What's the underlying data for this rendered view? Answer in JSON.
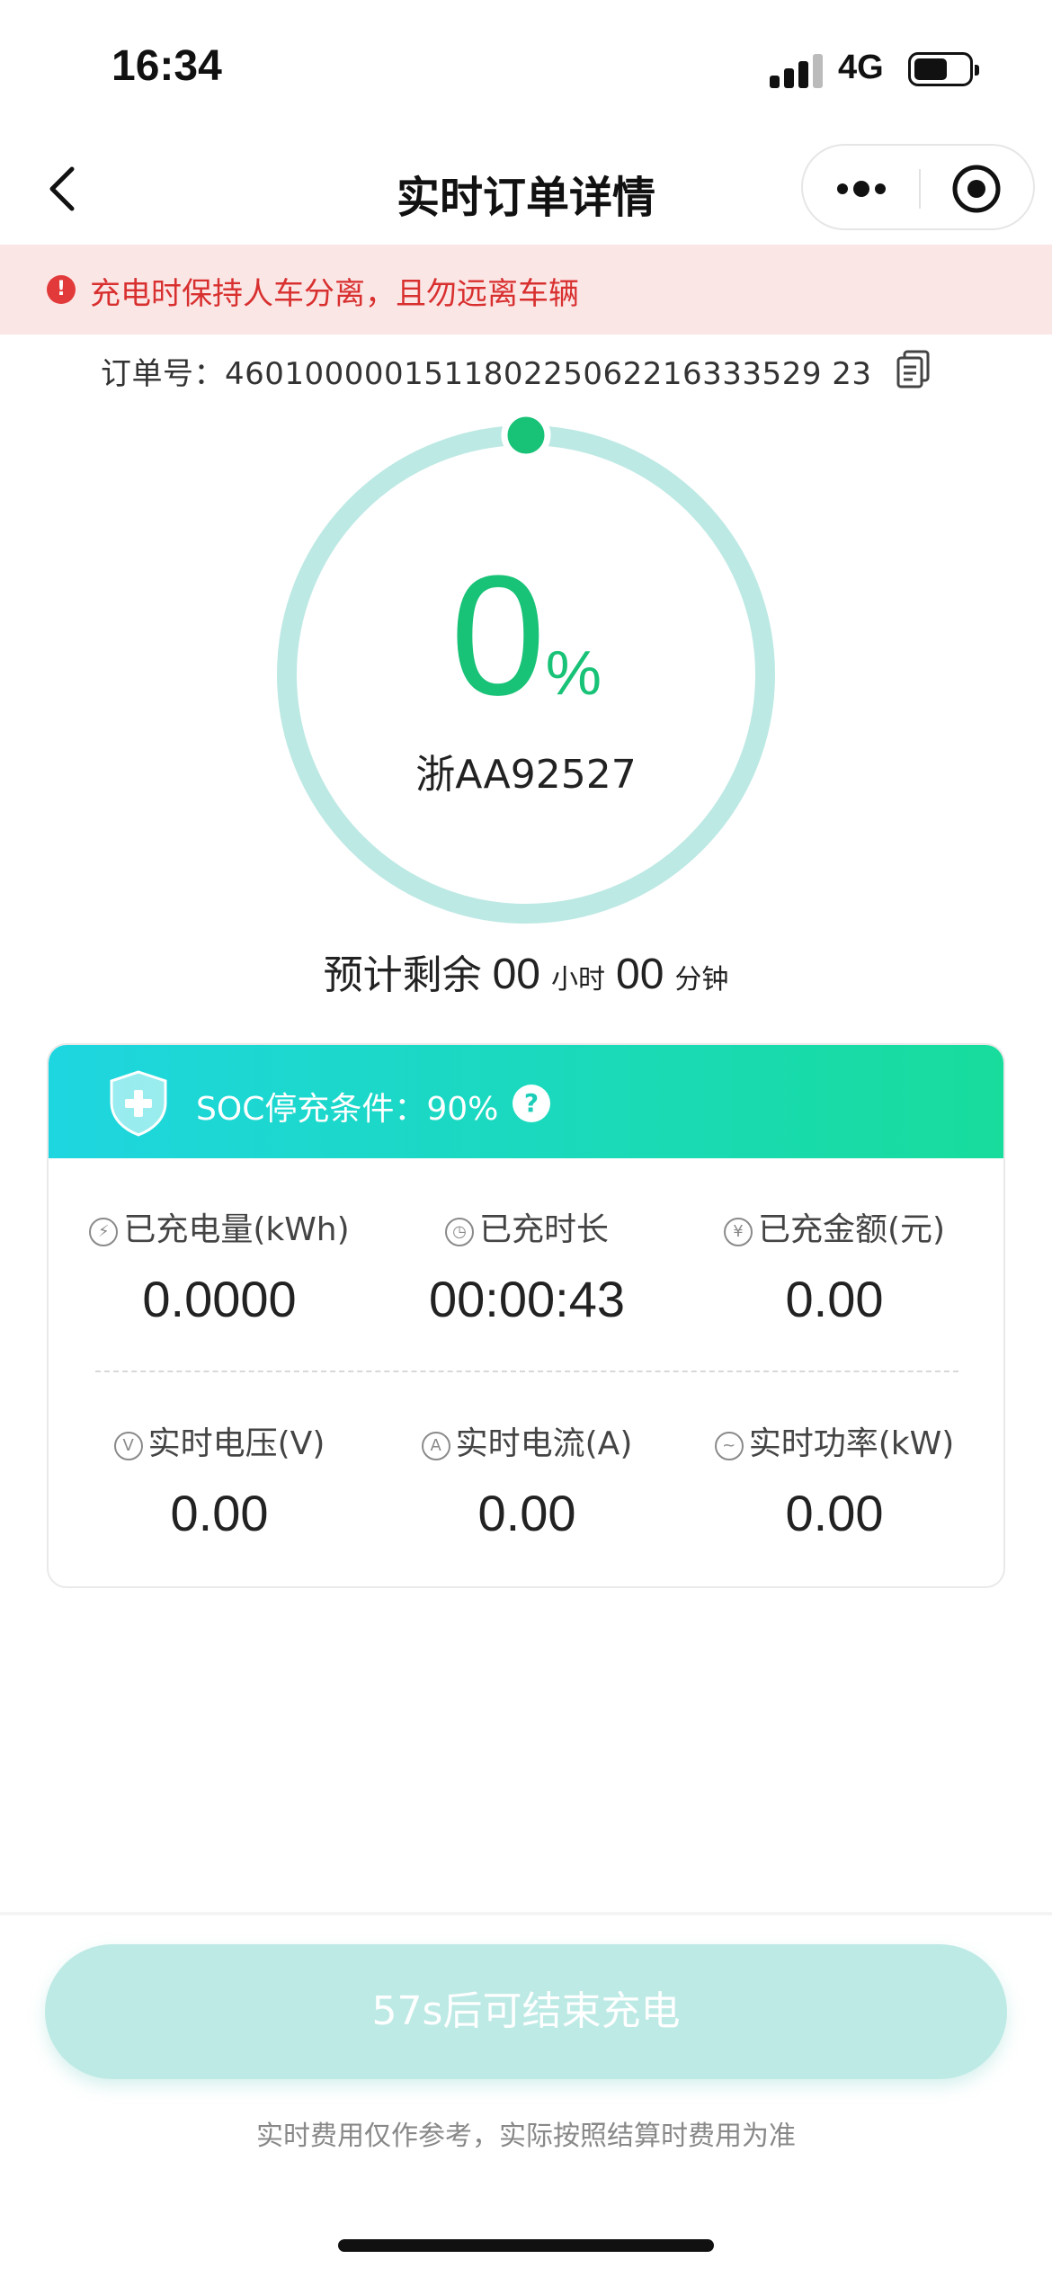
{
  "status_bar": {
    "time": "16:34",
    "network": "4G"
  },
  "nav": {
    "title": "实时订单详情"
  },
  "warning": {
    "icon": "!",
    "text": "充电时保持人车分离，且勿远离车辆"
  },
  "order": {
    "label": "订单号：",
    "number": "460100000151180225062216333529 23"
  },
  "progress": {
    "percent": "0",
    "percent_sign": "%",
    "fraction": 0.0,
    "plate": "浙AA92527"
  },
  "remaining": {
    "prefix": "预计剩余",
    "hours": "00",
    "hours_unit": "小时",
    "minutes": "00",
    "minutes_unit": "分钟"
  },
  "soc": {
    "label": "SOC停充条件：",
    "value": "90%",
    "help": "?"
  },
  "stats": {
    "energy_label": "已充电量(kWh)",
    "energy_value": "0.0000",
    "duration_label": "已充时长",
    "duration_value": "00:00:43",
    "amount_label": "已充金额(元)",
    "amount_value": "0.00",
    "voltage_label": "实时电压(V)",
    "voltage_value": "0.00",
    "current_label": "实时电流(A)",
    "current_value": "0.00",
    "power_label": "实时功率(kW)",
    "power_value": "0.00"
  },
  "icons": {
    "energy": "⚡",
    "duration": "◷",
    "amount": "¥",
    "voltage": "V",
    "current": "A",
    "power": "~"
  },
  "end_button": {
    "label": "57s后可结束充电"
  },
  "footer_note": "实时费用仅作参考，实际按照结算时费用为准",
  "colors": {
    "accent": "#18c277",
    "ring_track": "#bde9e4",
    "warning_text": "#d8302f",
    "warning_bg": "#fbe6e6",
    "button_bg": "#bdeae5"
  }
}
